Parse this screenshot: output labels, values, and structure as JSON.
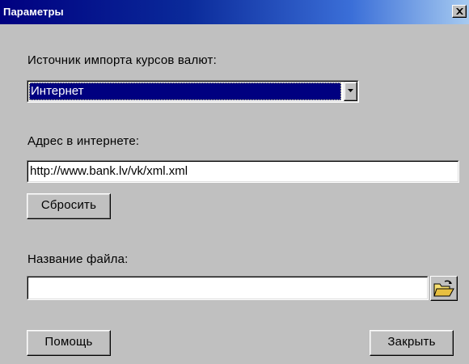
{
  "window": {
    "title": "Параметры"
  },
  "import_source": {
    "label": "Источник импорта курсов валют:",
    "selected_value": "Интернет"
  },
  "internet_address": {
    "label": "Адрес в интернете:",
    "value": "http://www.bank.lv/vk/xml.xml",
    "reset_button": "Сбросить"
  },
  "file_name": {
    "label": "Название файла:",
    "value": ""
  },
  "footer": {
    "help_button": "Помощь",
    "close_button": "Закрыть"
  },
  "icons": {
    "close": "close-icon",
    "dropdown": "chevron-down-icon",
    "browse": "open-folder-icon"
  },
  "colors": {
    "dialog_face": "#c0c0c0",
    "titlebar_start": "#000080",
    "titlebar_end": "#a6caf0",
    "selection": "#000080"
  }
}
